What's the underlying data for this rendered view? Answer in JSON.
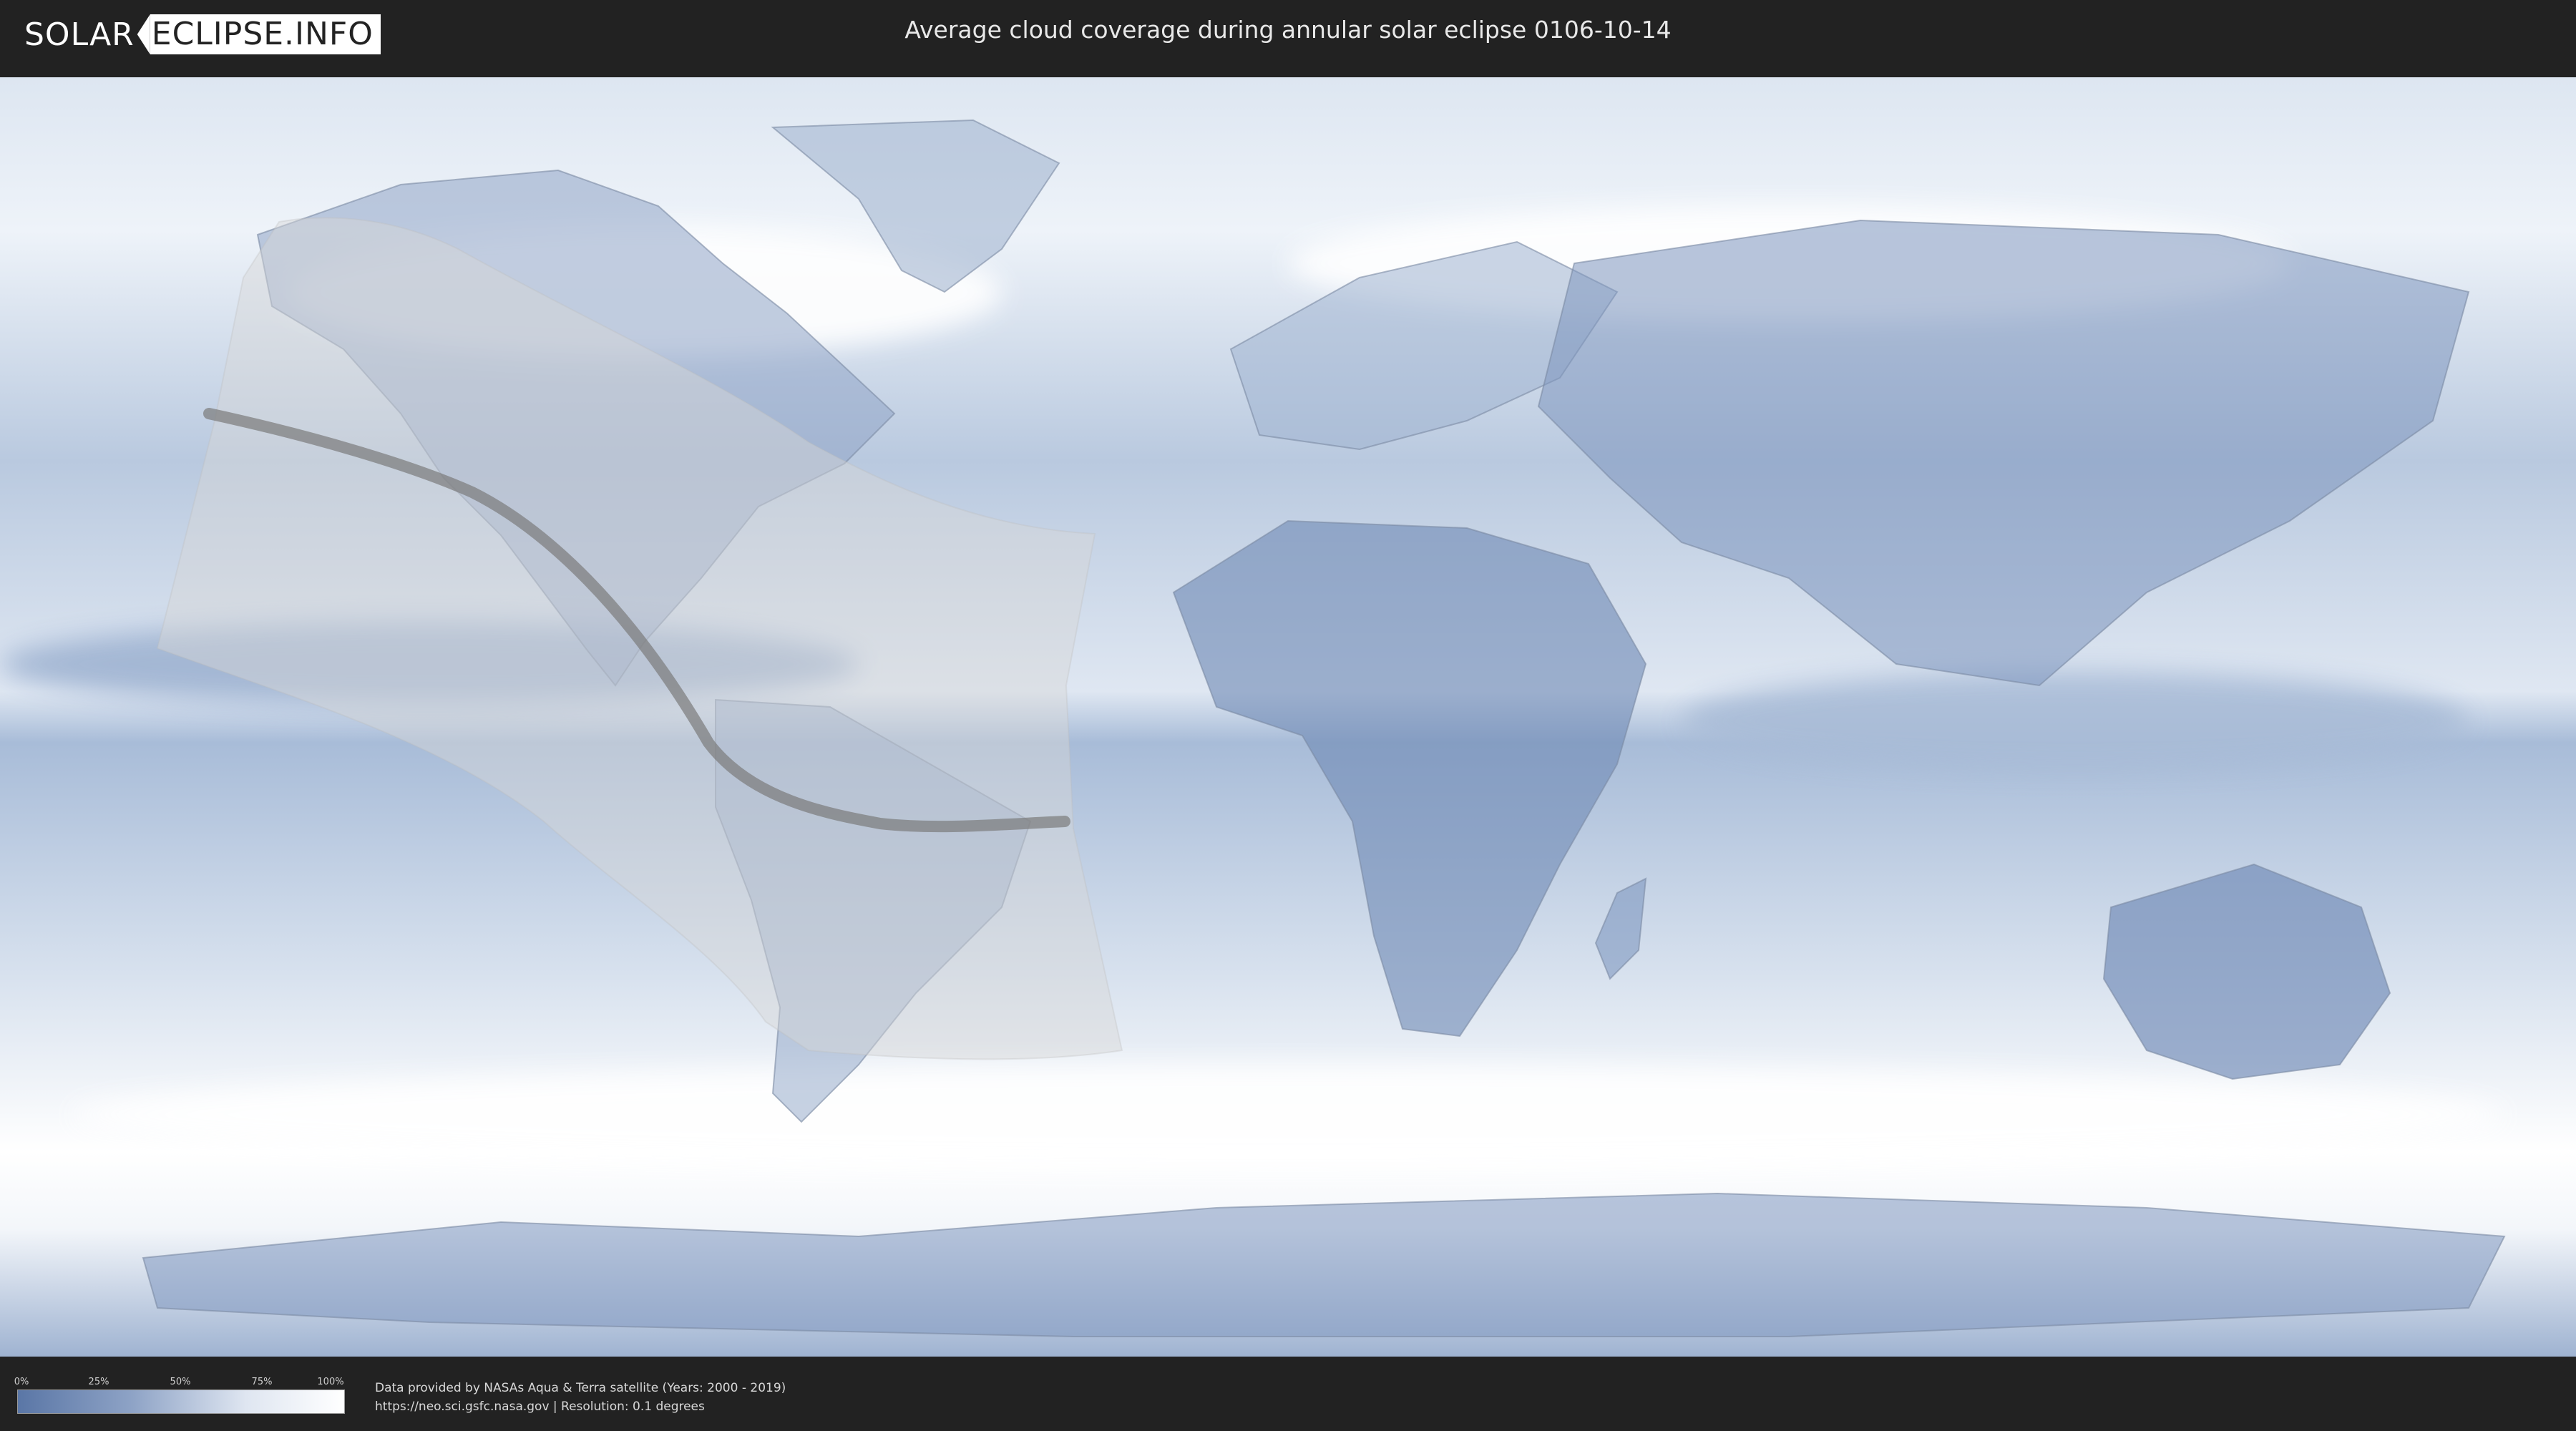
{
  "header": {
    "logo_part1": "SOLAR",
    "logo_part2": "ECLIPSE.INFO",
    "title": "Average cloud coverage during annular solar eclipse 0106-10-14"
  },
  "legend": {
    "ticks": [
      "0%",
      "25%",
      "50%",
      "75%",
      "100%"
    ],
    "gradient_start": "#5a76a6",
    "gradient_end": "#ffffff"
  },
  "footer": {
    "credit_line1": "Data provided by NASAs Aqua & Terra satellite (Years: 2000 - 2019)",
    "credit_line2": "https://neo.sci.gsfc.nasa.gov | Resolution: 0.1 degrees"
  },
  "colors": {
    "ocean_cloud_base": "#c9d6e8",
    "land_low_cloud": "#6e88b4",
    "high_cloud": "#ffffff",
    "eclipse_zone": "#d8d8d8",
    "central_path": "#7a7a7a"
  },
  "icons": [
    "solar-eclipse-logo-icon"
  ]
}
